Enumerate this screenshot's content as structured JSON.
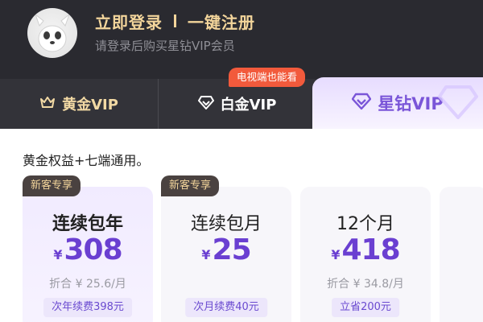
{
  "header": {
    "login_label": "立即登录",
    "register_label": "一键注册",
    "hint": "请登录后购买星钻VIP会员"
  },
  "tabs": [
    {
      "label": "黄金VIP",
      "icon": "crown-icon"
    },
    {
      "label": "白金VIP",
      "icon": "diamond-icon"
    },
    {
      "label": "星钻VIP",
      "icon": "star-diamond-icon",
      "selected": true
    }
  ],
  "tv_badge": "电视端也能看",
  "benefit_desc": "黄金权益+七端通用。",
  "plans": [
    {
      "badge": "新客专享",
      "title": "连续包年",
      "currency": "¥",
      "price": "308",
      "sub": "折合 ¥ 25.6/月",
      "tag": "次年续费398元"
    },
    {
      "badge": "新客专享",
      "title": "连续包月",
      "currency": "¥",
      "price": "25",
      "sub": "",
      "tag": "次月续费40元"
    },
    {
      "badge": "",
      "title": "12个月",
      "currency": "¥",
      "price": "418",
      "sub": "折合 ¥ 34.8/月",
      "tag": "立省200元"
    }
  ],
  "colors": {
    "header_bg": "#2a2a30",
    "gold": "#f3d59b",
    "accent_purple": "#6a3fd1",
    "badge_red": "#f25a3c"
  }
}
